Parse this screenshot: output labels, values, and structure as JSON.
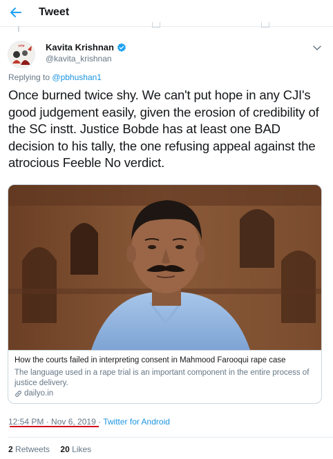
{
  "header": {
    "title": "Tweet",
    "back_icon": "arrow-left-icon",
    "accent_color": "#1da1f2"
  },
  "tweet": {
    "author": {
      "name": "Kavita Krishnan",
      "handle": "@kavita_krishnan",
      "verified": true,
      "avatar_icon": "profile-avatar"
    },
    "replying_prefix": "Replying to",
    "replying_to": "@pbhushan1",
    "text": "Once burned twice shy. We can't put hope in any CJI's good judgement easily, given the erosion of credibility of the SC instt. Justice Bobde has at least one BAD decision to his tally, the one refusing appeal against the atrocious Feeble No verdict.",
    "card": {
      "title": "How the courts failed in interpreting consent in Mahmood Farooqui rape case",
      "description": "The language used in a rape trial is an important component in the entire process of justice delivery.",
      "domain": "dailyo.in",
      "image_icon": "photo-of-man-with-mustache"
    },
    "timestamp": "12:54 PM · Nov 6, 2019",
    "separator": " · ",
    "source": "Twitter for Android",
    "retweets_count": "2",
    "retweets_label": "Retweets",
    "likes_count": "20",
    "likes_label": "Likes"
  },
  "colors": {
    "link": "#1b95e0",
    "secondary_text": "#657786",
    "annotation_underline": "#d0021b"
  }
}
